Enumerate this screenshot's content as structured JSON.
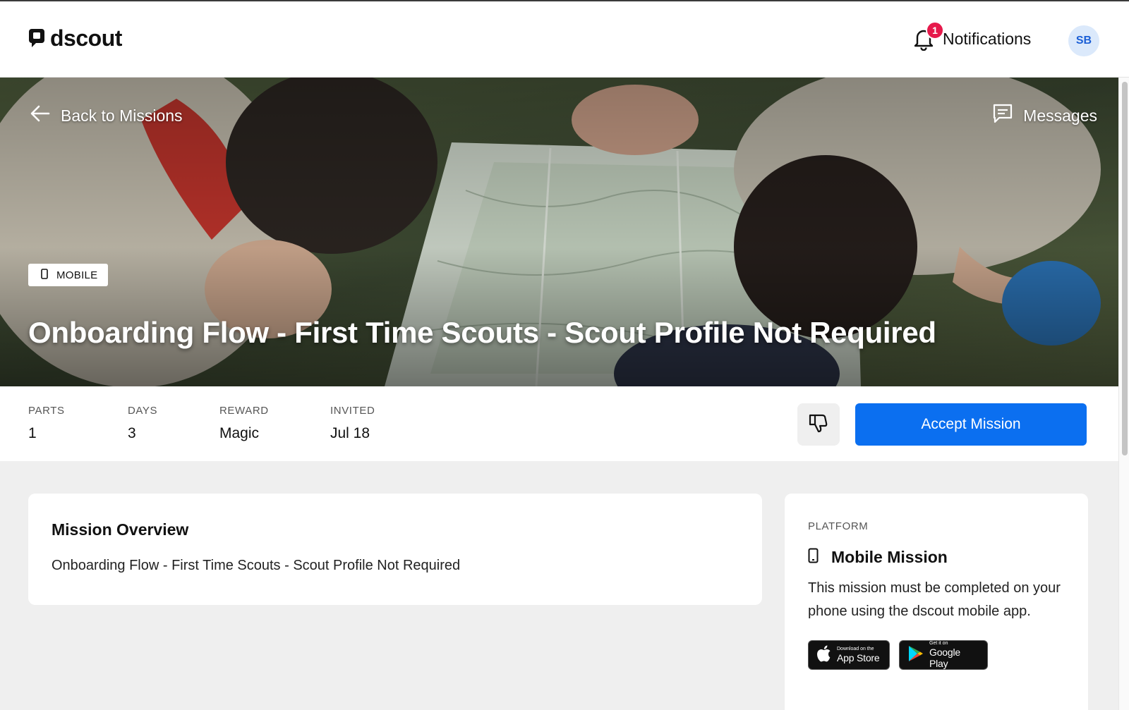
{
  "app": {
    "brand": "dscout"
  },
  "header": {
    "notifications_label": "Notifications",
    "notifications_count": "1",
    "avatar_initials": "SB"
  },
  "hero": {
    "back_label": "Back to Missions",
    "messages_label": "Messages",
    "tag_label": "MOBILE",
    "title": "Onboarding Flow - First Time Scouts - Scout Profile Not Required"
  },
  "stats": {
    "items": [
      {
        "label": "PARTS",
        "value": "1"
      },
      {
        "label": "DAYS",
        "value": "3"
      },
      {
        "label": "REWARD",
        "value": "Magic"
      },
      {
        "label": "INVITED",
        "value": "Jul 18"
      }
    ],
    "accept_label": "Accept Mission"
  },
  "overview": {
    "heading": "Mission Overview",
    "body": "Onboarding Flow - First Time Scouts - Scout Profile Not Required"
  },
  "platform": {
    "label": "PLATFORM",
    "title": "Mobile Mission",
    "description": "This mission must be completed on your phone using the dscout mobile app.",
    "app_store": {
      "small": "Download on the",
      "big": "App Store"
    },
    "google_play": {
      "small": "Get it on",
      "big": "Google Play"
    }
  },
  "colors": {
    "accent": "#0b6ff0",
    "badge": "#e6194b",
    "avatar_bg": "#dbe9fb",
    "avatar_text": "#1b5fd6"
  },
  "icons": [
    "dscout-logo-icon",
    "bell-icon",
    "arrow-left-icon",
    "chat-icon",
    "phone-icon",
    "thumbs-down-icon",
    "apple-icon",
    "google-play-icon"
  ]
}
